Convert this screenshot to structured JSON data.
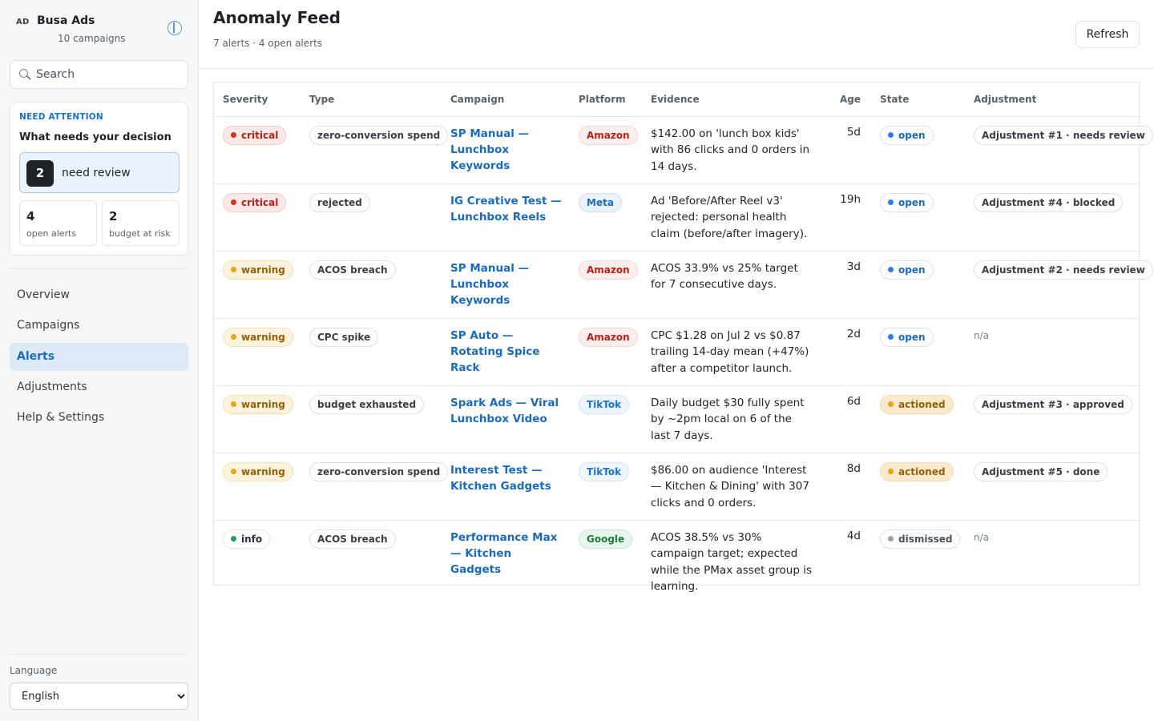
{
  "brand": {
    "badge": "AD",
    "name": "Busa Ads",
    "subtitle": "10 campaigns"
  },
  "search": {
    "placeholder": "Search"
  },
  "attention": {
    "kicker": "NEED ATTENTION",
    "title": "What needs your decision",
    "review": {
      "count": "2",
      "label": "need review"
    },
    "open_alerts": {
      "count": "4",
      "label": "open alerts"
    },
    "budget_risk": {
      "count": "2",
      "label": "budget at risk"
    }
  },
  "nav": {
    "items": [
      {
        "label": "Overview",
        "active": false
      },
      {
        "label": "Campaigns",
        "active": false
      },
      {
        "label": "Alerts",
        "active": true
      },
      {
        "label": "Adjustments",
        "active": false
      },
      {
        "label": "Help & Settings",
        "active": false
      }
    ]
  },
  "language": {
    "label": "Language",
    "selected": "English"
  },
  "header": {
    "title": "Anomaly Feed",
    "subtitle": "7 alerts · 4 open alerts",
    "refresh_label": "Refresh"
  },
  "table": {
    "columns": [
      "Severity",
      "Type",
      "Campaign",
      "Platform",
      "Evidence",
      "Age",
      "State",
      "Adjustment"
    ],
    "rows": [
      {
        "severity": "critical",
        "type": "zero-conversion spend",
        "campaign": "SP Manual — Lunchbox Keywords",
        "platform": "Amazon",
        "evidence": "$142.00 on 'lunch box kids' with 86 clicks and 0 orders in 14 days.",
        "age": "5d",
        "state": "open",
        "adjustment": "Adjustment #1 · needs review"
      },
      {
        "severity": "critical",
        "type": "rejected",
        "campaign": "IG Creative Test — Lunchbox Reels",
        "platform": "Meta",
        "evidence": "Ad 'Before/After Reel v3' rejected: personal health claim (before/after imagery).",
        "age": "19h",
        "state": "open",
        "adjustment": "Adjustment #4 · blocked"
      },
      {
        "severity": "warning",
        "type": "ACOS breach",
        "campaign": "SP Manual — Lunchbox Keywords",
        "platform": "Amazon",
        "evidence": "ACOS 33.9% vs 25% target for 7 consecutive days.",
        "age": "3d",
        "state": "open",
        "adjustment": "Adjustment #2 · needs review"
      },
      {
        "severity": "warning",
        "type": "CPC spike",
        "campaign": "SP Auto — Rotating Spice Rack",
        "platform": "Amazon",
        "evidence": "CPC $1.28 on Jul 2 vs $0.87 trailing 14-day mean (+47%) after a competitor launch.",
        "age": "2d",
        "state": "open",
        "adjustment": "n/a"
      },
      {
        "severity": "warning",
        "type": "budget exhausted",
        "campaign": "Spark Ads — Viral Lunchbox Video",
        "platform": "TikTok",
        "evidence": "Daily budget $30 fully spent by ~2pm local on 6 of the last 7 days.",
        "age": "6d",
        "state": "actioned",
        "adjustment": "Adjustment #3 · approved"
      },
      {
        "severity": "warning",
        "type": "zero-conversion spend",
        "campaign": "Interest Test — Kitchen Gadgets",
        "platform": "TikTok",
        "evidence": "$86.00 on audience 'Interest — Kitchen & Dining' with 307 clicks and 0 orders.",
        "age": "8d",
        "state": "actioned",
        "adjustment": "Adjustment #5 · done"
      },
      {
        "severity": "info",
        "type": "ACOS breach",
        "campaign": "Performance Max — Kitchen Gadgets",
        "platform": "Google",
        "evidence": "ACOS 38.5% vs 30% campaign target; expected while the PMax asset group is learning.",
        "age": "4d",
        "state": "dismissed",
        "adjustment": "n/a"
      }
    ]
  }
}
